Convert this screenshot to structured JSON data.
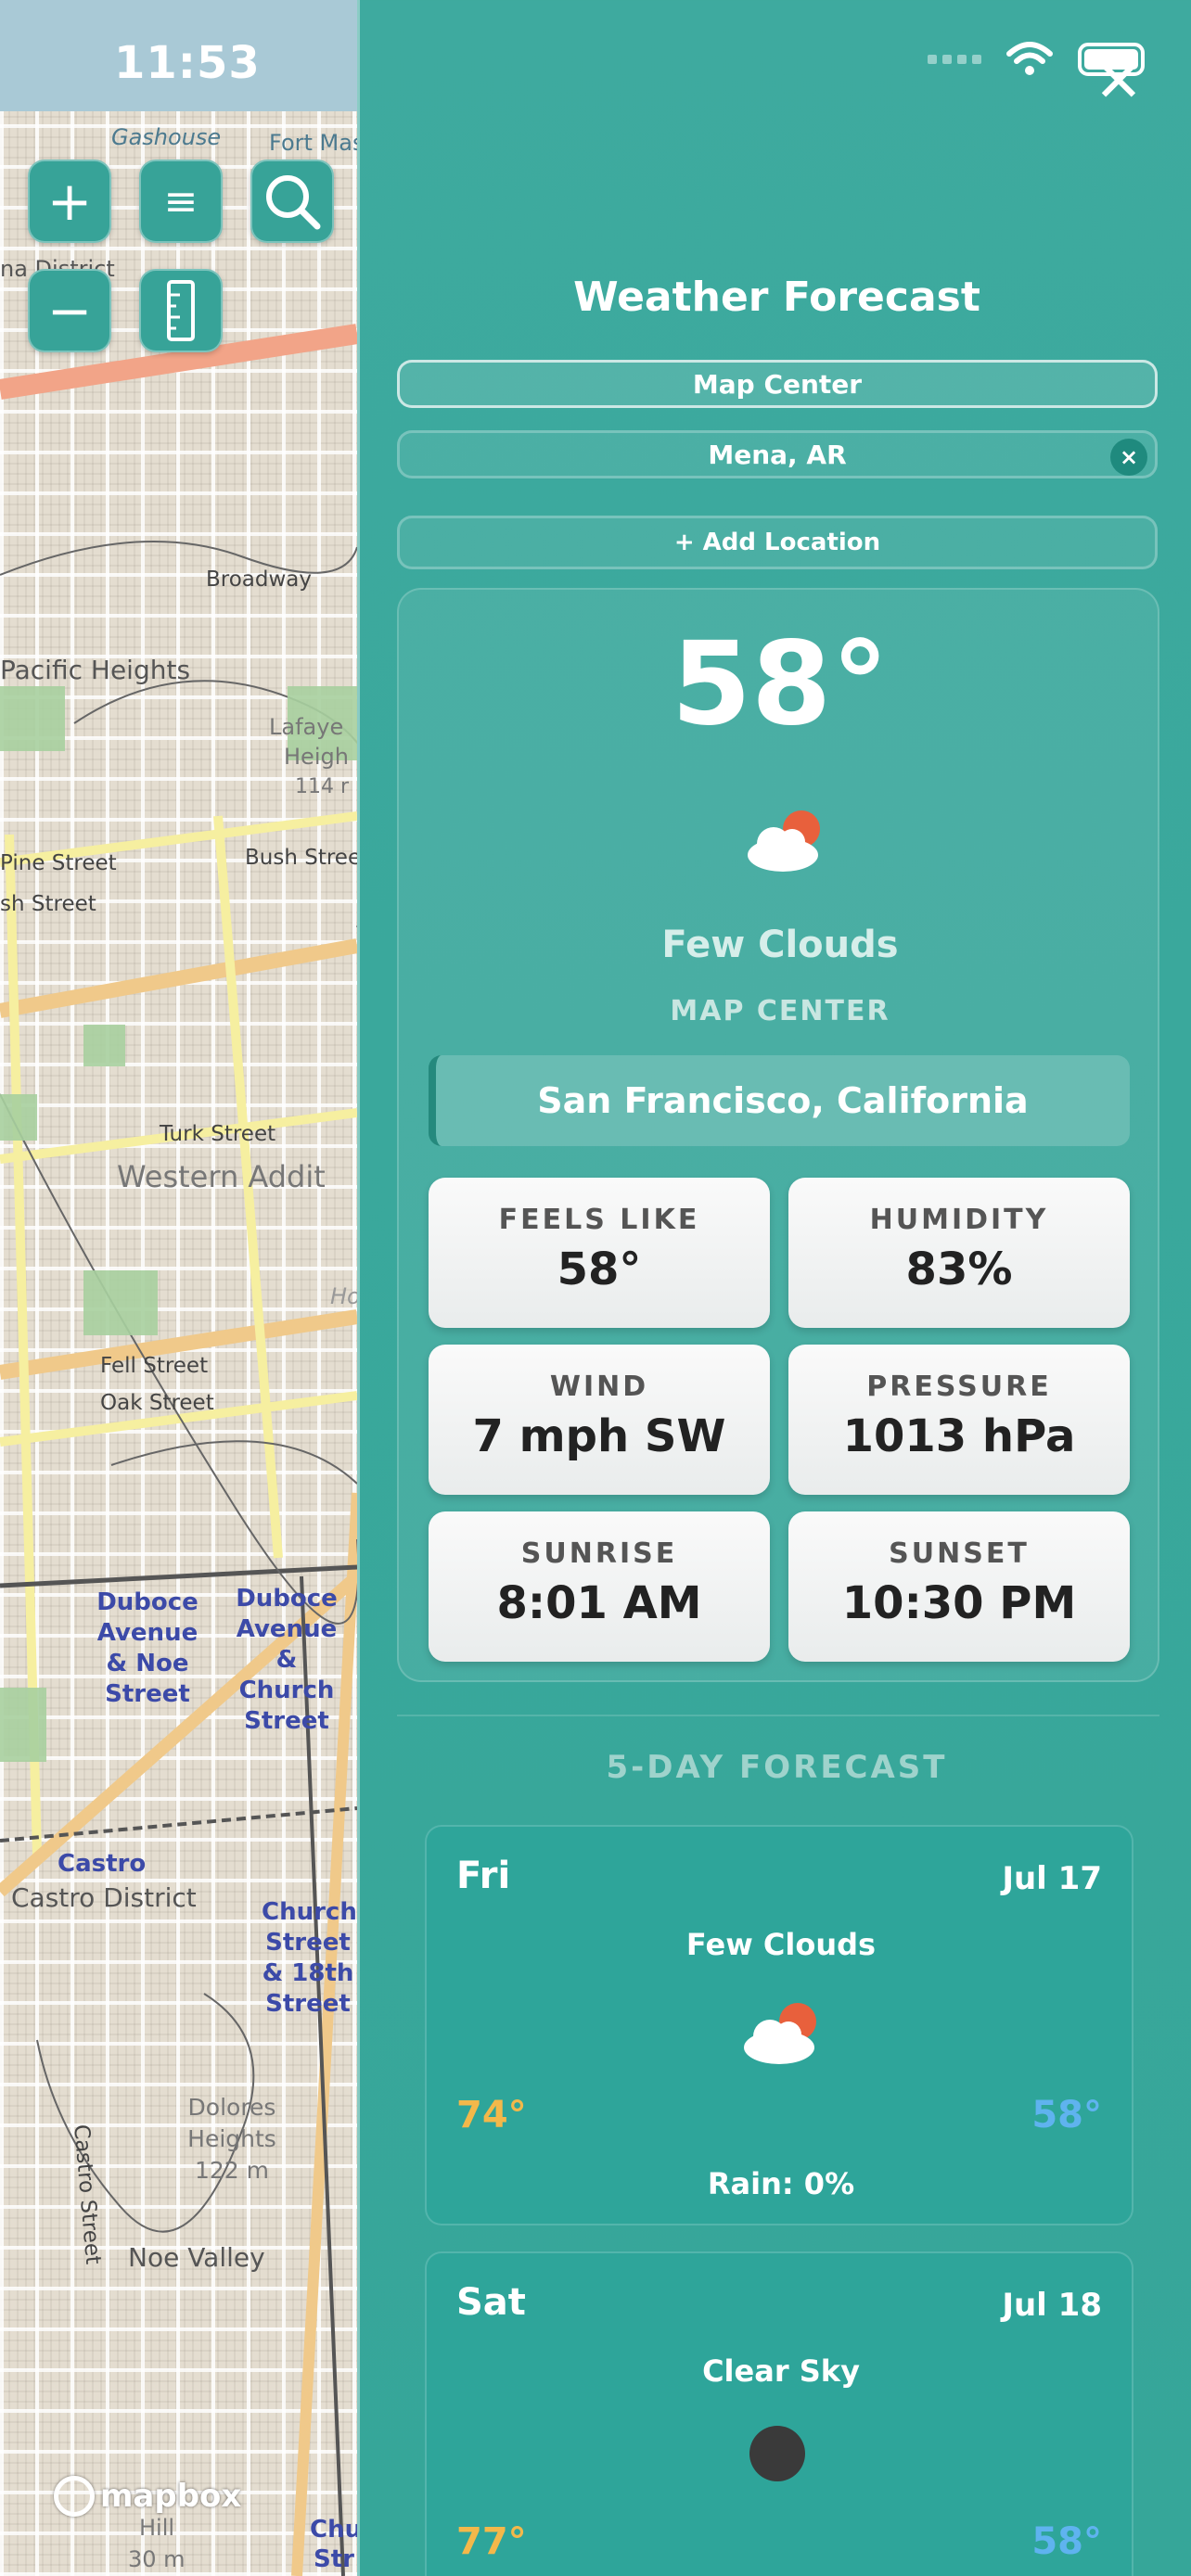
{
  "status_bar": {
    "time": "11:53"
  },
  "map": {
    "attribution": "mapbox",
    "labels": {
      "gashouse": "Gashouse",
      "fort_mason": "Fort Mason",
      "marina": "na District",
      "broadway": "Broadway",
      "pacific_heights": "Pacific Heights",
      "lafayette": "Lafaye",
      "heights": "Heigh",
      "elev114": "114 r",
      "pine": "Pine Street",
      "sh_street": "sh Street",
      "bush": "Bush Stree",
      "turk": "Turk Street",
      "western_addition": "Western Addit",
      "fell": "Fell Street",
      "oak": "Oak Street",
      "ho": "Ho",
      "duboce_noe": "Duboce Avenue & Noe Street",
      "duboce_church": "Duboce Avenue & Church Street",
      "castro": "Castro",
      "castro_district": "Castro District",
      "church_18th": "Church Street & 18th Street",
      "castro_street": "Castro Street",
      "dolores": "Dolores Heights 122 m",
      "noe_valley": "Noe Valley",
      "hill": "Hill",
      "elev30": "30 m",
      "chu": "Chu",
      "str": "Str"
    },
    "buttons": {
      "zoom_in": "+",
      "zoom_out": "−",
      "menu": "≡"
    }
  },
  "panel": {
    "title": "Weather Forecast",
    "locations": [
      {
        "label": "Map Center",
        "selected": true
      },
      {
        "label": "Mena, AR",
        "selected": false,
        "remove": "×"
      }
    ],
    "add_location": "+ Add Location",
    "current": {
      "temperature": "58°",
      "condition": "Few Clouds",
      "source": "MAP CENTER",
      "city": "San Francisco, California",
      "stats": [
        {
          "label": "FEELS LIKE",
          "value": "58°"
        },
        {
          "label": "HUMIDITY",
          "value": "83%"
        },
        {
          "label": "WIND",
          "value": "7 mph SW"
        },
        {
          "label": "PRESSURE",
          "value": "1013 hPa"
        },
        {
          "label": "SUNRISE",
          "value": "8:01 AM"
        },
        {
          "label": "SUNSET",
          "value": "10:30 PM"
        }
      ]
    },
    "forecast_title": "5-DAY FORECAST",
    "forecast": [
      {
        "day": "Fri",
        "date": "Jul 17",
        "condition": "Few Clouds",
        "icon": "few-clouds-icon",
        "high": "74°",
        "low": "58°",
        "rain": "Rain: 0%"
      },
      {
        "day": "Sat",
        "date": "Jul 18",
        "condition": "Clear Sky",
        "icon": "clear-night-icon",
        "high": "77°",
        "low": "58°"
      }
    ]
  },
  "colors": {
    "panel_bg": "#3aa89c",
    "high_temp": "#f3b84a",
    "low_temp": "#5fb3ef",
    "sun_accent": "#e8603c"
  }
}
